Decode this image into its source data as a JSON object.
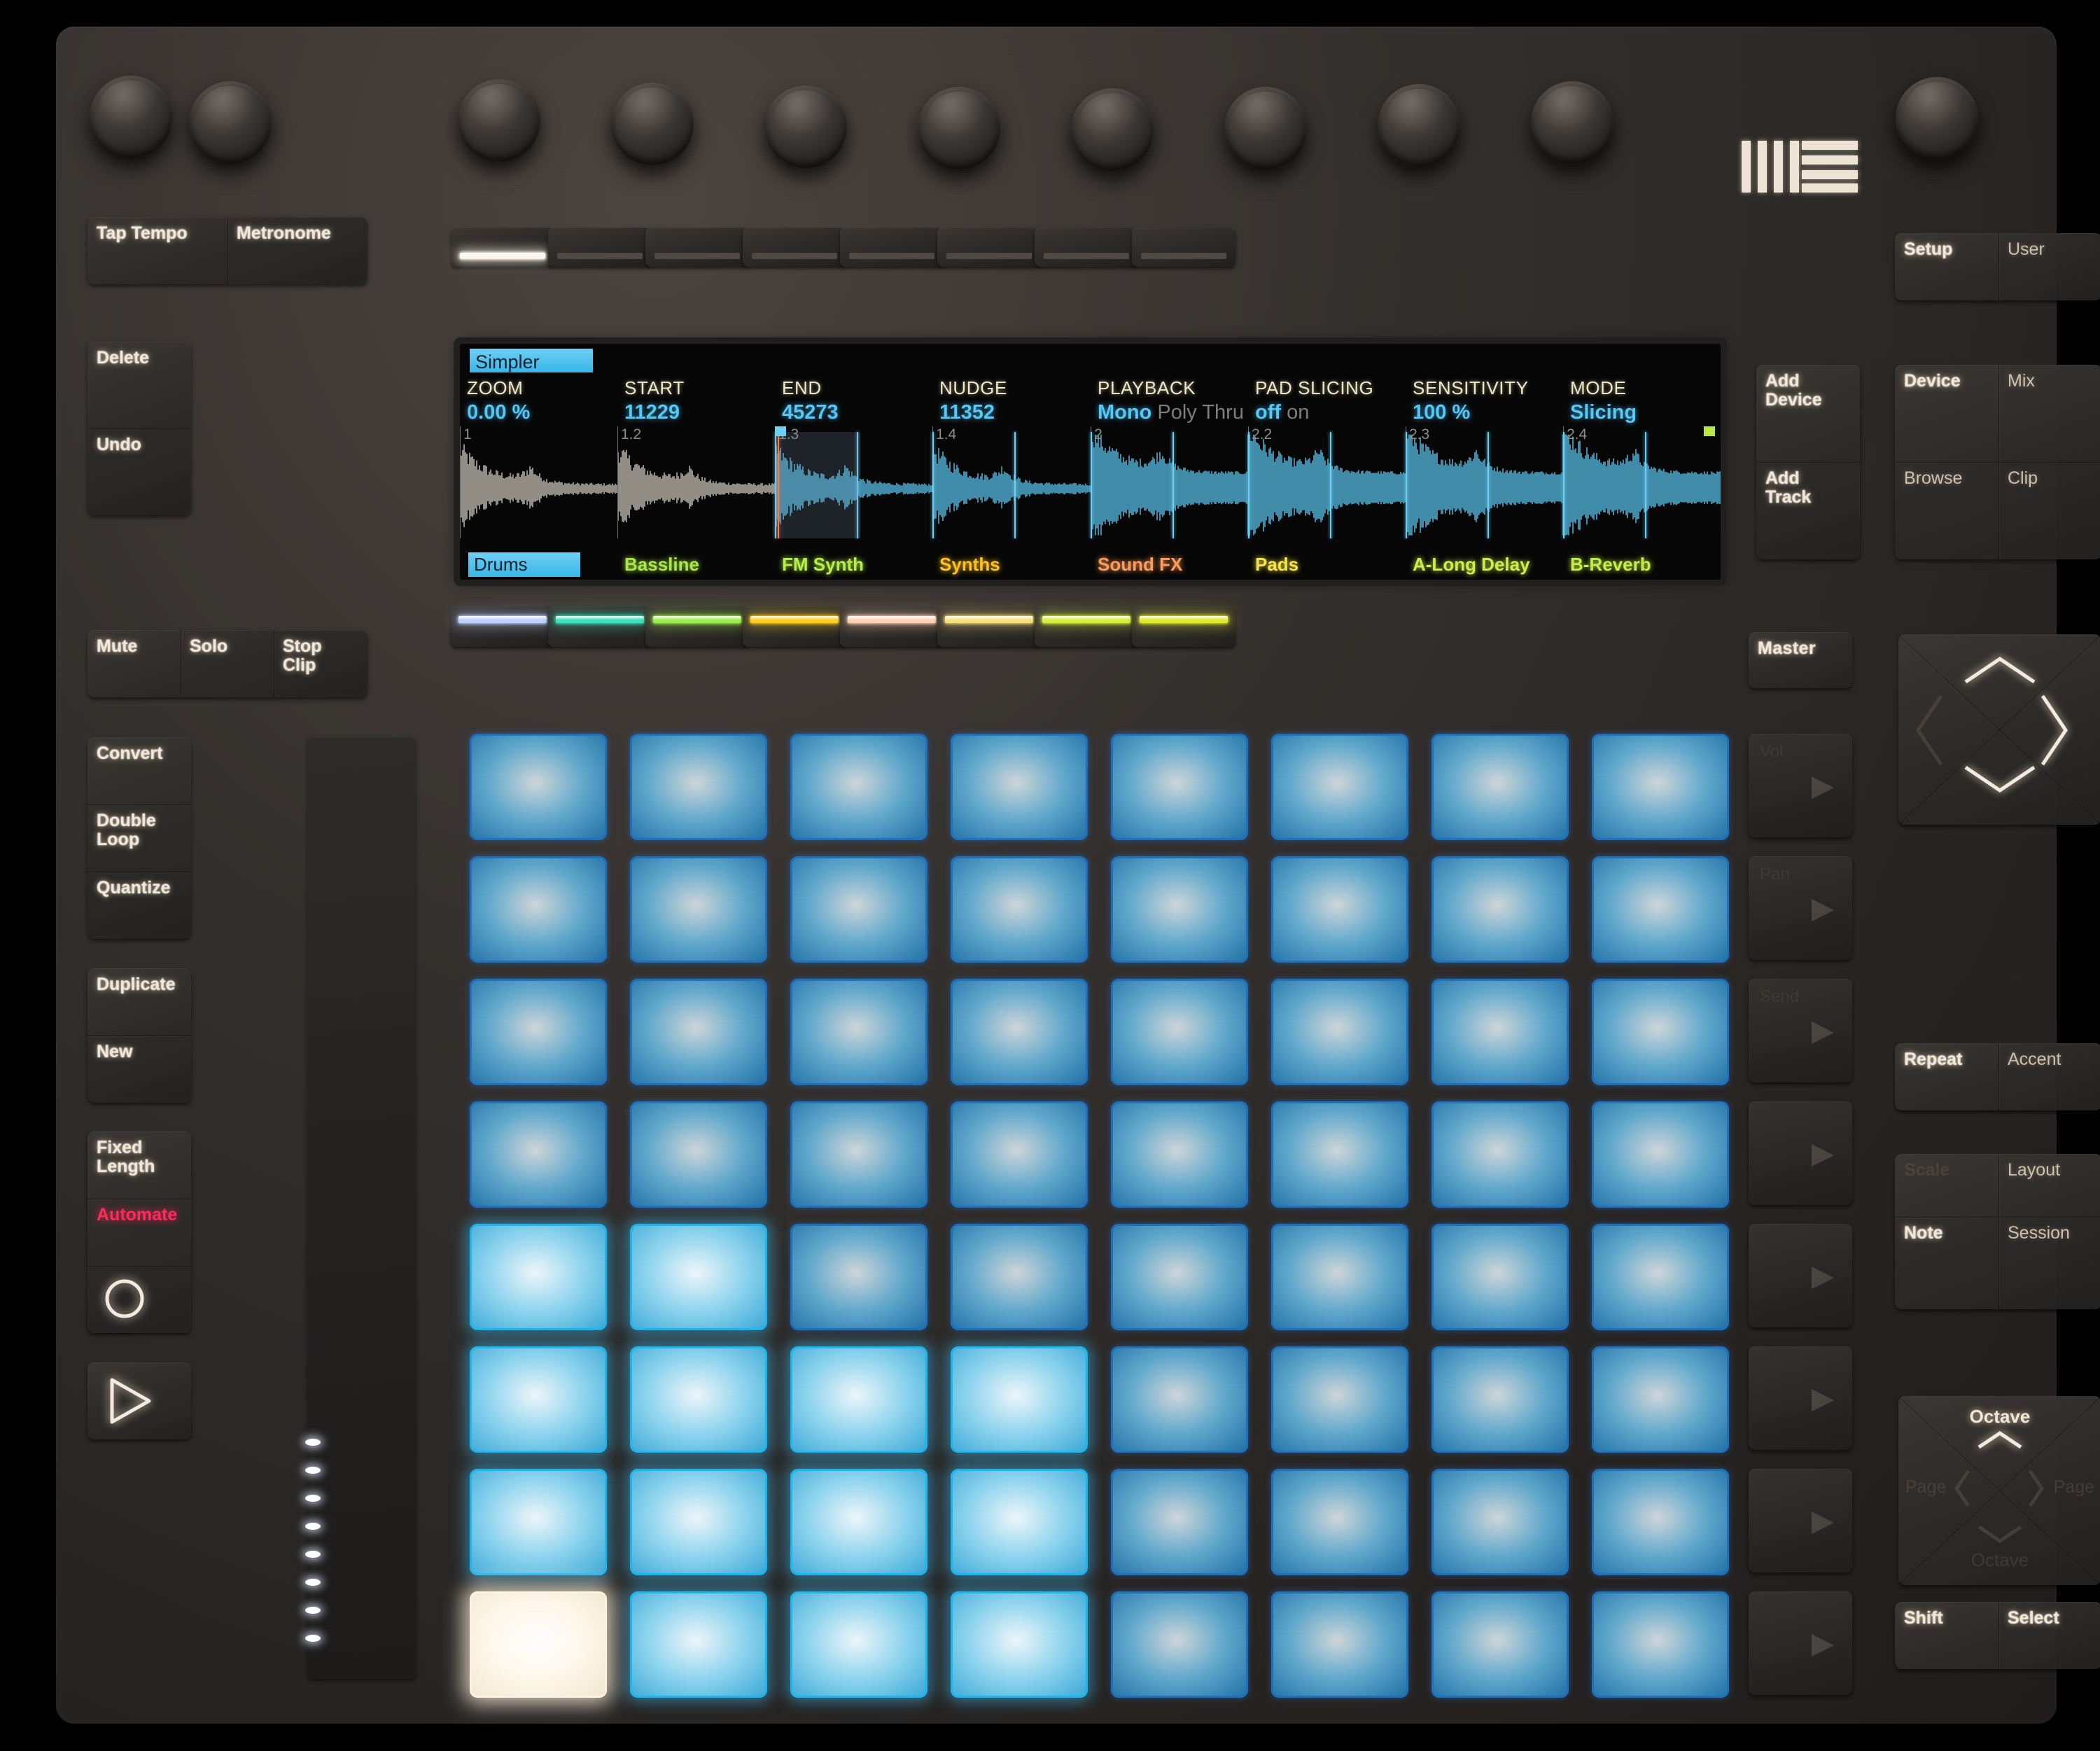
{
  "device": {
    "brand_logo": "ableton-logo"
  },
  "top_left_buttons": {
    "tap_tempo": "Tap Tempo",
    "metronome": "Metronome"
  },
  "edit_buttons": {
    "delete": "Delete",
    "undo": "Undo"
  },
  "track_state_buttons": {
    "mute": "Mute",
    "solo": "Solo",
    "stop_clip": "Stop\nClip"
  },
  "clip_buttons": {
    "convert": "Convert",
    "double_loop": "Double\nLoop",
    "quantize": "Quantize",
    "duplicate": "Duplicate",
    "new": "New",
    "fixed_length": "Fixed\nLength",
    "automate": "Automate",
    "record": "record-circle-icon",
    "play": "play-triangle-icon"
  },
  "right_top_buttons": {
    "setup": "Setup",
    "user": "User"
  },
  "add_buttons": {
    "add_device": "Add\nDevice",
    "add_track": "Add\nTrack"
  },
  "mode_buttons": {
    "device": "Device",
    "mix": "Mix",
    "browse": "Browse",
    "clip": "Clip"
  },
  "master_button": {
    "label": "Master"
  },
  "performance_buttons": {
    "repeat": "Repeat",
    "accent": "Accent"
  },
  "note_buttons": {
    "scale": "Scale",
    "layout": "Layout",
    "note": "Note",
    "session": "Session"
  },
  "octave_pad": {
    "octave_up": "Octave",
    "octave_down": "Octave",
    "page_left": "Page",
    "page_right": "Page",
    "up_icon": "chevron-up-icon",
    "down_icon": "chevron-down-icon",
    "left_icon": "chevron-left-icon",
    "right_icon": "chevron-right-icon"
  },
  "bottom_right_buttons": {
    "shift": "Shift",
    "select": "Select"
  },
  "nav_diamond": {
    "up_icon": "chevron-up-icon",
    "down_icon": "chevron-down-icon",
    "left_icon": "chevron-left-icon",
    "right_icon": "chevron-right-icon"
  },
  "display": {
    "tab": "Simpler",
    "parameters": [
      {
        "name": "ZOOM",
        "value": "0.00 %"
      },
      {
        "name": "START",
        "value": "11229"
      },
      {
        "name": "END",
        "value": "45273"
      },
      {
        "name": "NUDGE",
        "value": "11352"
      },
      {
        "name": "PLAYBACK",
        "value": "Mono",
        "inactive": "Poly Thru"
      },
      {
        "name": "PAD SLICING",
        "value": "off",
        "inactive": "on"
      },
      {
        "name": "SENSITIVITY",
        "value": "100 %"
      },
      {
        "name": "MODE",
        "value": "Slicing"
      }
    ],
    "bar_markers": [
      "1",
      "1.2",
      "1.3",
      "1.4",
      "2",
      "2.2",
      "2.3",
      "2.4"
    ],
    "tracks": [
      {
        "label": "Drums",
        "color": "#7fdcff",
        "selected": true
      },
      {
        "label": "Bassline",
        "color": "#a9e84a",
        "selected": false
      },
      {
        "label": "FM Synth",
        "color": "#b6f24a",
        "selected": false
      },
      {
        "label": "Synths",
        "color": "#ffc21e",
        "selected": false
      },
      {
        "label": "Sound FX",
        "color": "#ff9b5c",
        "selected": false
      },
      {
        "label": "Pads",
        "color": "#f7e44a",
        "selected": false
      },
      {
        "label": "A-Long Delay",
        "color": "#cdf04a",
        "selected": false
      },
      {
        "label": "B-Reverb",
        "color": "#c6ef4a",
        "selected": false
      }
    ]
  },
  "top_row_leds": [
    {
      "on": true
    },
    {
      "on": false
    },
    {
      "on": false
    },
    {
      "on": false
    },
    {
      "on": false
    },
    {
      "on": false
    },
    {
      "on": false
    },
    {
      "on": false
    }
  ],
  "track_leds": [
    {
      "color": "#bfd2ff"
    },
    {
      "color": "#3fe0c0"
    },
    {
      "color": "#9cf04c"
    },
    {
      "color": "#ffcf1e"
    },
    {
      "color": "#ffd2b4"
    },
    {
      "color": "#f5e27a"
    },
    {
      "color": "#d6f03c"
    },
    {
      "color": "#e1ec2f"
    }
  ],
  "pad_grid": {
    "rows": 8,
    "cols": 8,
    "brightness": [
      [
        1,
        1,
        1,
        1,
        1,
        1,
        1,
        1
      ],
      [
        1,
        1,
        1,
        1,
        1,
        1,
        1,
        1
      ],
      [
        1,
        1,
        1,
        1,
        1,
        1,
        1,
        1
      ],
      [
        1,
        1,
        1,
        1,
        1,
        1,
        1,
        1
      ],
      [
        3,
        3,
        1,
        1,
        1,
        1,
        1,
        1
      ],
      [
        3,
        3,
        3,
        3,
        1,
        1,
        1,
        1
      ],
      [
        3,
        3,
        3,
        3,
        1,
        1,
        1,
        1
      ],
      [
        4,
        3,
        3,
        3,
        1,
        1,
        1,
        1
      ]
    ]
  },
  "touch_strip": {
    "lit_dots": 8,
    "total_dots": 8
  },
  "scene_buttons": [
    {
      "ghost": "Vol",
      "icon": "play-arrow-icon"
    },
    {
      "ghost": "Pan",
      "icon": "play-arrow-icon"
    },
    {
      "ghost": "Send",
      "icon": "play-arrow-icon"
    },
    {
      "ghost": "",
      "icon": "play-arrow-icon"
    },
    {
      "ghost": "",
      "icon": "play-arrow-icon"
    },
    {
      "ghost": "",
      "icon": "play-arrow-icon"
    },
    {
      "ghost": "",
      "icon": "play-arrow-icon"
    },
    {
      "ghost": "",
      "icon": "play-arrow-icon"
    }
  ]
}
